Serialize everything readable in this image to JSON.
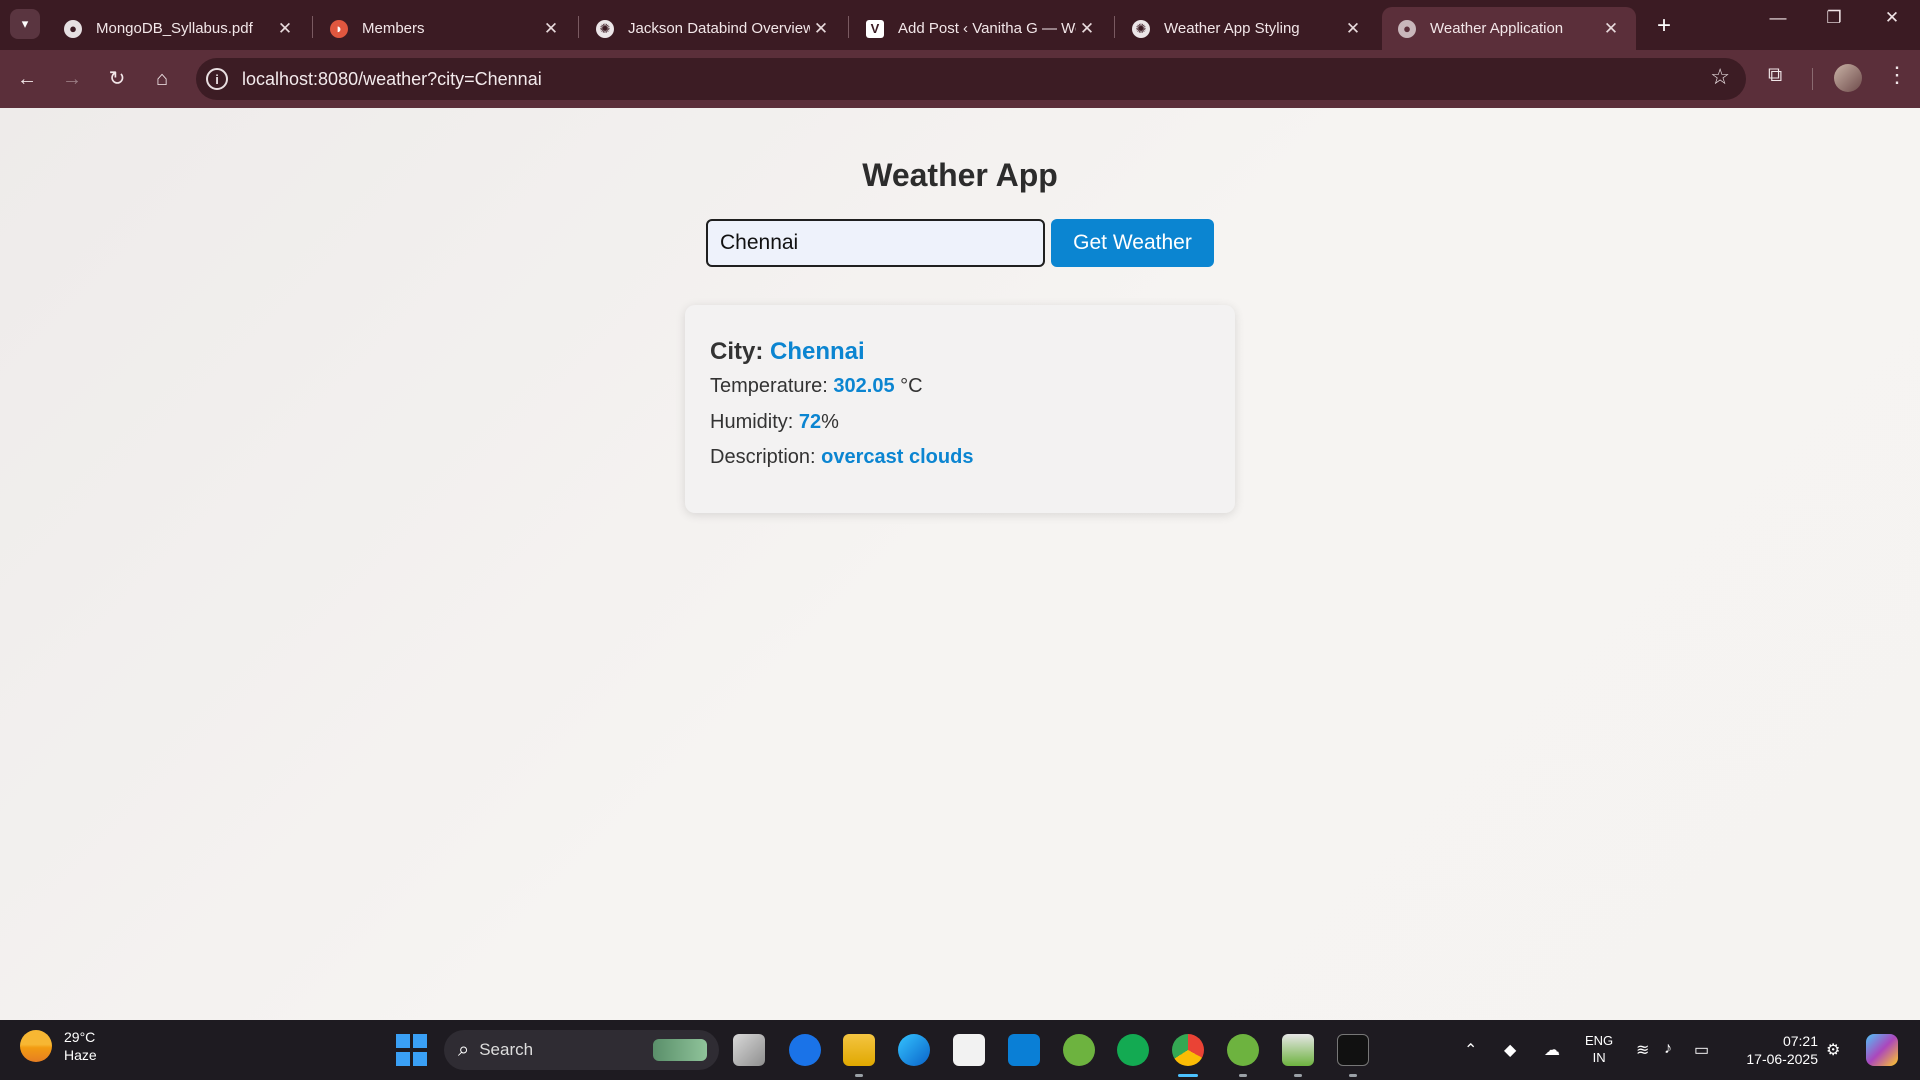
{
  "browser": {
    "tabs": [
      {
        "title": "MongoDB_Syllabus.pdf",
        "active": false
      },
      {
        "title": "Members",
        "active": false
      },
      {
        "title": "Jackson Databind Overview",
        "active": false
      },
      {
        "title": "Add Post ‹ Vanitha G — WordPress",
        "active": false
      },
      {
        "title": "Weather App Styling",
        "active": false
      },
      {
        "title": "Weather Application",
        "active": true
      }
    ],
    "url": "localhost:8080/weather?city=Chennai"
  },
  "app": {
    "title": "Weather App",
    "city_input_value": "Chennai",
    "button_label": "Get Weather",
    "result": {
      "city_label": "City:",
      "city": "Chennai",
      "temperature_label": "Temperature:",
      "temperature": "302.05",
      "temperature_unit": "°C",
      "humidity_label": "Humidity:",
      "humidity": "72",
      "humidity_unit": "%",
      "description_label": "Description:",
      "description": "overcast clouds"
    }
  },
  "taskbar": {
    "weather_temp": "29°C",
    "weather_desc": "Haze",
    "search_label": "Search",
    "lang_line1": "ENG",
    "lang_line2": "IN",
    "time": "07:21",
    "date": "17-06-2025"
  },
  "colors": {
    "accent": "#0b85d1",
    "chrome": "#5b2f3a",
    "tabstrip": "#3b1b23"
  }
}
